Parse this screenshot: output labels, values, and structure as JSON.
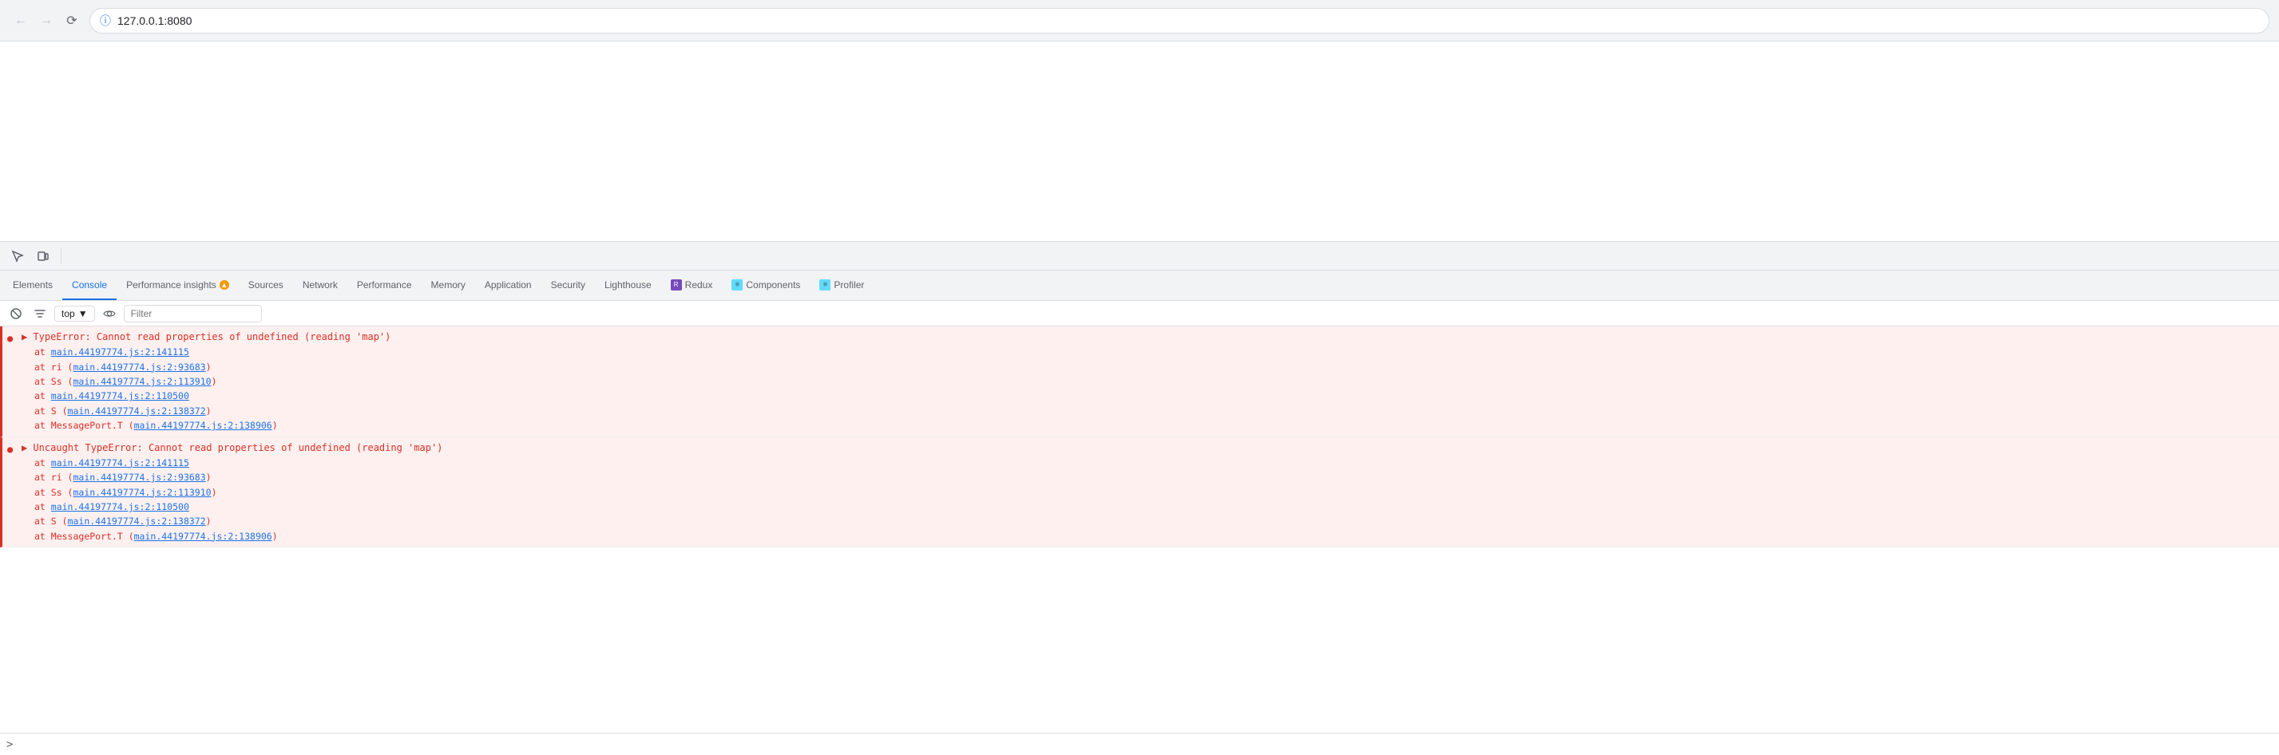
{
  "browser": {
    "url": "127.0.0.1:8080",
    "back_disabled": true,
    "forward_disabled": true
  },
  "devtools": {
    "tabs": [
      {
        "id": "elements",
        "label": "Elements",
        "active": false
      },
      {
        "id": "console",
        "label": "Console",
        "active": true
      },
      {
        "id": "performance-insights",
        "label": "Performance insights",
        "active": false,
        "has_warning": true
      },
      {
        "id": "sources",
        "label": "Sources",
        "active": false
      },
      {
        "id": "network",
        "label": "Network",
        "active": false
      },
      {
        "id": "performance",
        "label": "Performance",
        "active": false
      },
      {
        "id": "memory",
        "label": "Memory",
        "active": false
      },
      {
        "id": "application",
        "label": "Application",
        "active": false
      },
      {
        "id": "security",
        "label": "Security",
        "active": false
      },
      {
        "id": "lighthouse",
        "label": "Lighthouse",
        "active": false
      },
      {
        "id": "redux",
        "label": "Redux",
        "active": false,
        "has_redux_icon": true
      },
      {
        "id": "components",
        "label": "Components",
        "active": false,
        "has_components_icon": true
      },
      {
        "id": "profiler",
        "label": "Profiler",
        "active": false,
        "has_profiler_icon": true
      }
    ],
    "console": {
      "context": "top",
      "filter_placeholder": "Filter",
      "errors": [
        {
          "id": "error1",
          "main_text": "TypeError: Cannot read properties of undefined (reading 'map')",
          "stack": [
            {
              "prefix": "at ",
              "text": "main.44197774.js:2:141115",
              "is_link": true
            },
            {
              "prefix": "at ri (",
              "text": "main.44197774.js:2:93683",
              "is_link": true,
              "suffix": ")"
            },
            {
              "prefix": "at Ss (",
              "text": "main.44197774.js:2:113910",
              "is_link": true,
              "suffix": ")"
            },
            {
              "prefix": "at ",
              "text": "main.44197774.js:2:110500",
              "is_link": true
            },
            {
              "prefix": "at S (",
              "text": "main.44197774.js:2:138372",
              "is_link": true,
              "suffix": ")"
            },
            {
              "prefix": "at MessagePort.T (",
              "text": "main.44197774.js:2:138906",
              "is_link": true,
              "suffix": ")"
            }
          ]
        },
        {
          "id": "error2",
          "main_text": "Uncaught TypeError: Cannot read properties of undefined (reading 'map')",
          "stack": [
            {
              "prefix": "at ",
              "text": "main.44197774.js:2:141115",
              "is_link": true
            },
            {
              "prefix": "at ri (",
              "text": "main.44197774.js:2:93683",
              "is_link": true,
              "suffix": ")"
            },
            {
              "prefix": "at Ss (",
              "text": "main.44197774.js:2:113910",
              "is_link": true,
              "suffix": ")"
            },
            {
              "prefix": "at ",
              "text": "main.44197774.js:2:110500",
              "is_link": true
            },
            {
              "prefix": "at S (",
              "text": "main.44197774.js:2:138372",
              "is_link": true,
              "suffix": ")"
            },
            {
              "prefix": "at MessagePort.T (",
              "text": "main.44197774.js:2:138906",
              "is_link": true,
              "suffix": ")"
            }
          ]
        }
      ]
    }
  }
}
